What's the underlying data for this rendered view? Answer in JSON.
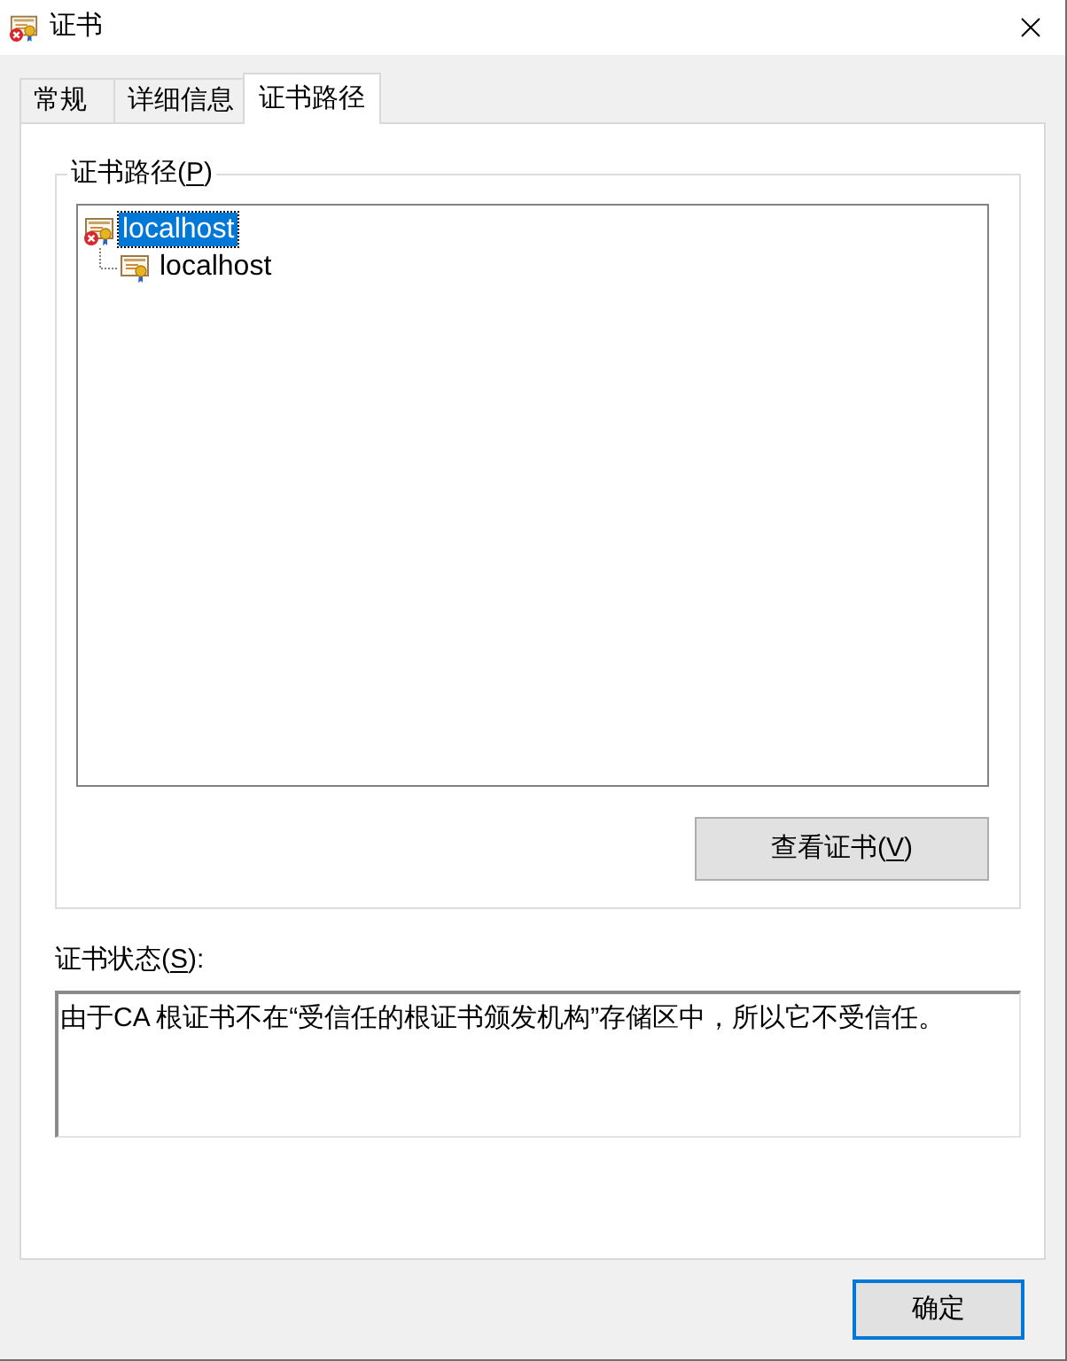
{
  "window": {
    "title": "证书"
  },
  "tabs": [
    {
      "label": "常规",
      "selected": false
    },
    {
      "label": "详细信息",
      "selected": false
    },
    {
      "label": "证书路径",
      "selected": true
    }
  ],
  "certification_path": {
    "label_start": "证书路径(",
    "mnemonic": "P",
    "label_end": ")",
    "tree": [
      {
        "label": "localhost",
        "selected": true,
        "error": true,
        "children": [
          {
            "label": "localhost",
            "selected": false,
            "error": false
          }
        ]
      }
    ],
    "view_button": {
      "label_start": "查看证书(",
      "mnemonic": "V",
      "label_end": ")"
    }
  },
  "certificate_status": {
    "label_start": "证书状态(",
    "mnemonic": "S",
    "label_end": "):",
    "text": "由于CA 根证书不在“受信任的根证书颁发机构”存储区中，所以它不受信任。"
  },
  "buttons": [
    {
      "label": "确定",
      "default": true
    }
  ]
}
